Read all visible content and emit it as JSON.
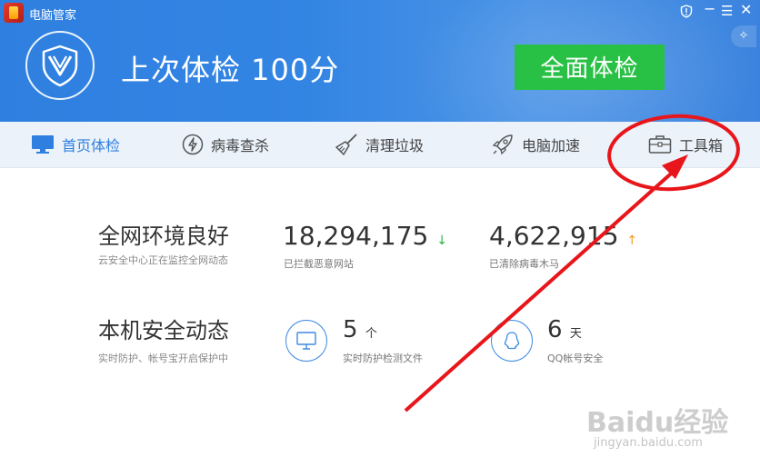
{
  "window": {
    "title": "电脑管家"
  },
  "hero": {
    "last_check": "上次体检 100分",
    "scan_button": "全面体检"
  },
  "tabs": [
    {
      "label": "首页体检",
      "icon": "monitor-icon",
      "active": true
    },
    {
      "label": "病毒查杀",
      "icon": "lightning-icon",
      "active": false
    },
    {
      "label": "清理垃圾",
      "icon": "broom-icon",
      "active": false
    },
    {
      "label": "电脑加速",
      "icon": "rocket-icon",
      "active": false
    },
    {
      "label": "工具箱",
      "icon": "toolbox-icon",
      "active": false
    }
  ],
  "network": {
    "heading": "全网环境良好",
    "subtitle": "云安全中心正在监控全网动态",
    "blocked_count": "18,294,175",
    "blocked_label": "已拦截恶意网站",
    "cleaned_count": "4,622,915",
    "cleaned_label": "已清除病毒木马"
  },
  "local": {
    "heading": "本机安全动态",
    "subtitle": "实时防护、帐号宝开启保护中",
    "files_count": "5",
    "files_unit": "个",
    "files_label": "实时防护检测文件",
    "qq_days": "6",
    "qq_unit": "天",
    "qq_label": "QQ帐号安全"
  },
  "watermark": {
    "brand": "Baidu经验",
    "url": "jingyan.baidu.com"
  },
  "colors": {
    "header_blue": "#2f7fe0",
    "scan_green": "#29c145",
    "tab_bg": "#ebf2fa",
    "annotation_red": "#e8161b"
  }
}
